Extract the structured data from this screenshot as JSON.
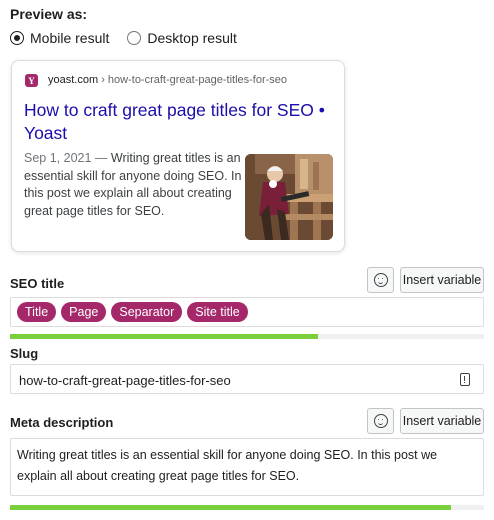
{
  "preview": {
    "label": "Preview as:",
    "options": [
      {
        "label": "Mobile result",
        "checked": true
      },
      {
        "label": "Desktop result",
        "checked": false
      }
    ]
  },
  "serp": {
    "domain": "yoast.com",
    "path": " › how-to-craft-great-page-titles-for-seo",
    "title": "How to craft great page titles for SEO • Yoast",
    "date": "Sep 1, 2021",
    "separator": " — ",
    "description": "Writing great titles is an essential skill for anyone doing SEO. In this post we explain all about creating great page titles for SEO.",
    "favicon_letter": "Y"
  },
  "seo_title": {
    "label": "SEO title",
    "insert_variable": "Insert variable",
    "tokens": [
      "Title",
      "Page",
      "Separator",
      "Site title"
    ],
    "progress": 0.65
  },
  "slug": {
    "label": "Slug",
    "value": "how-to-craft-great-page-titles-for-seo"
  },
  "meta_description": {
    "label": "Meta description",
    "insert_variable": "Insert variable",
    "value": "Writing great titles is an essential skill for anyone doing SEO. In this post we explain all about creating great page titles for SEO.",
    "progress": 0.93
  },
  "colors": {
    "accent": "#a4286a",
    "link": "#1a0dab",
    "progress_good": "#7ad03a"
  }
}
